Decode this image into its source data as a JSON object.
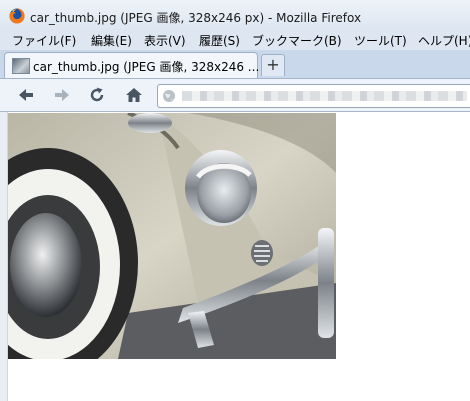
{
  "window": {
    "title": "car_thumb.jpg (JPEG 画像, 328x246 px) - Mozilla Firefox"
  },
  "menu": {
    "items": [
      {
        "label": "ファイル(F)"
      },
      {
        "label": "編集(E)"
      },
      {
        "label": "表示(V)"
      },
      {
        "label": "履歴(S)"
      },
      {
        "label": "ブックマーク(B)"
      },
      {
        "label": "ツール(T)"
      },
      {
        "label": "ヘルプ(H)"
      }
    ]
  },
  "tabs": [
    {
      "label": "car_thumb.jpg (JPEG 画像, 328x246 ...",
      "active": true
    }
  ],
  "new_tab_label": "+",
  "toolbar": {
    "back_icon": "back-arrow-icon",
    "forward_icon": "forward-arrow-icon",
    "reload_icon": "reload-icon",
    "home_icon": "home-icon",
    "url_value": ""
  },
  "content": {
    "image_description_icon": "car-photo",
    "image_size": "328x246"
  },
  "colors": {
    "chrome_bg": "#dde6f1",
    "tab_active": "#f3f7fb",
    "navbar_bg": "#eef3f9"
  }
}
